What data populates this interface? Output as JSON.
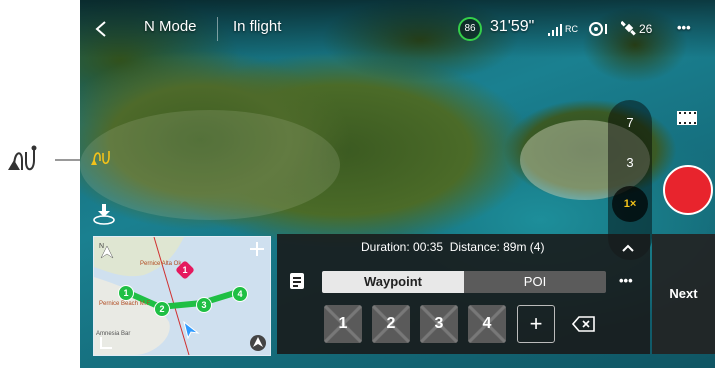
{
  "topbar": {
    "back_icon": "chevron-left-icon",
    "mode": "N Mode",
    "status": "In flight",
    "battery_percent": "86",
    "flight_time": "31'59\"",
    "rc_label": "RC",
    "satellites": "26",
    "more": "•••"
  },
  "zoom": {
    "levels": [
      "7",
      "3"
    ],
    "selected": "1×"
  },
  "route_panel": {
    "duration_label": "Duration:",
    "duration_value": "00:35",
    "distance_label": "Distance:",
    "distance_value": "89m (4)",
    "tab_waypoint": "Waypoint",
    "tab_poi": "POI",
    "more": "•••",
    "waypoints": [
      "1",
      "2",
      "3",
      "4"
    ],
    "add": "+",
    "next_label": "Next"
  },
  "map": {
    "waypoints": [
      "1",
      "2",
      "3",
      "4"
    ],
    "poi": "1",
    "labels": [
      "Pernice Alta Ok",
      "Amnesia Bar",
      "Pernice Beach M.F"
    ]
  },
  "colors": {
    "accent": "#f3c21a",
    "record": "#e8242d",
    "route": "#1fbf44",
    "battery_ring": "#35d04a",
    "poi": "#e5195e"
  }
}
